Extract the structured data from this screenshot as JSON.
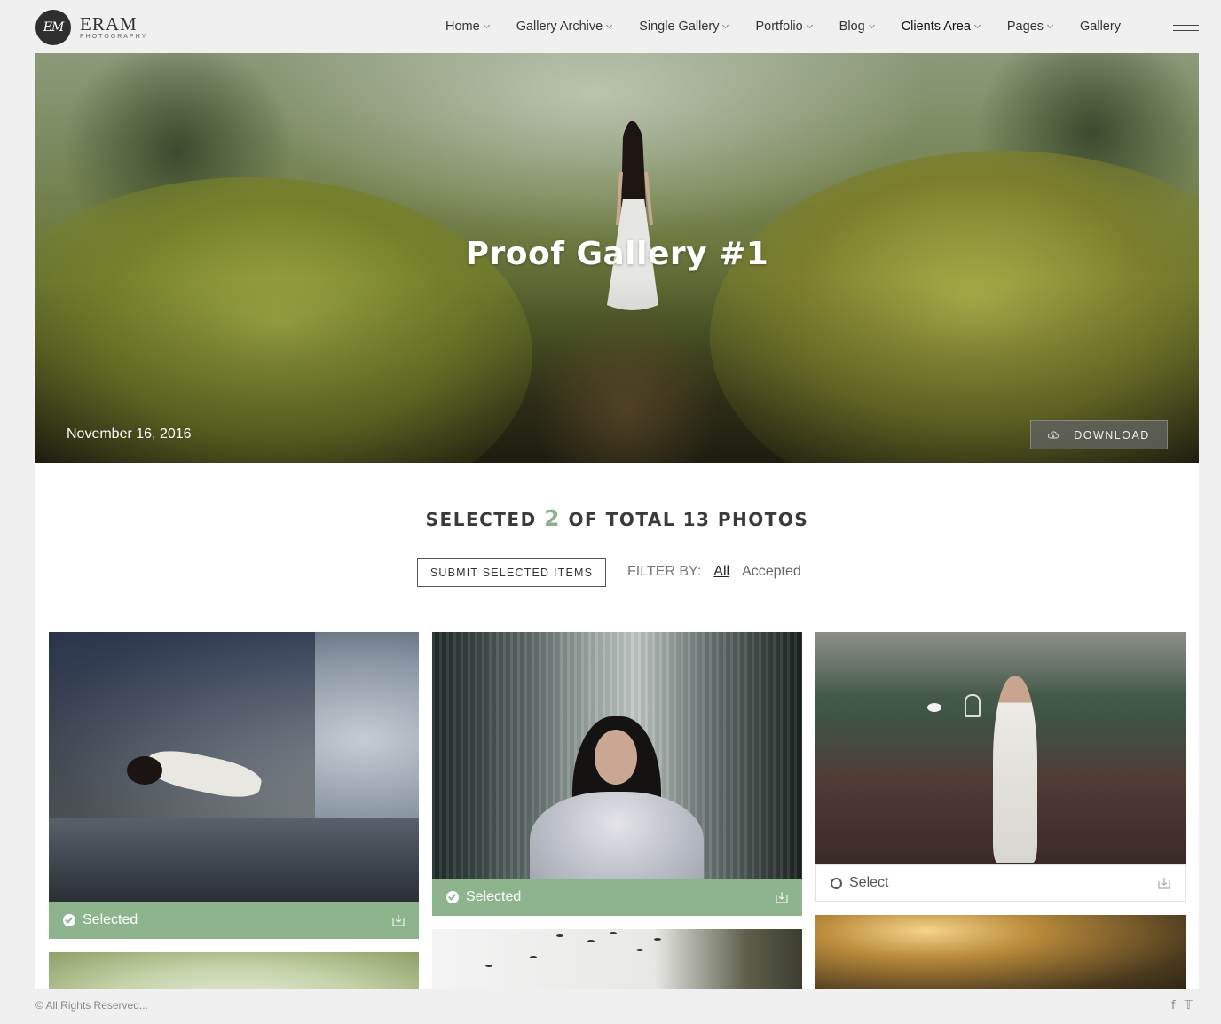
{
  "logo": {
    "monogram": "EM",
    "name": "ERAM",
    "tagline": "PHOTOGRAPHY"
  },
  "nav": [
    {
      "label": "Home",
      "dropdown": true
    },
    {
      "label": "Gallery Archive",
      "dropdown": true
    },
    {
      "label": "Single Gallery",
      "dropdown": true
    },
    {
      "label": "Portfolio",
      "dropdown": true
    },
    {
      "label": "Blog",
      "dropdown": true
    },
    {
      "label": "Clients Area",
      "dropdown": true,
      "active": true
    },
    {
      "label": "Pages",
      "dropdown": true
    },
    {
      "label": "Gallery",
      "dropdown": false
    }
  ],
  "hero": {
    "title": "Proof Gallery #1",
    "date": "November 16, 2016",
    "download_label": "DOWNLOAD"
  },
  "summary": {
    "prefix": "SELECTED",
    "selected_count": "2",
    "suffix": "OF TOTAL 13 PHOTOS"
  },
  "actions": {
    "submit_label": "SUBMIT SELECTED ITEMS",
    "filter_label": "FILTER BY:",
    "filter_options": [
      "All",
      "Accepted"
    ],
    "filter_active": "All"
  },
  "photos": [
    {
      "status_label": "Selected",
      "selected": true
    },
    {
      "status_label": "Selected",
      "selected": true
    },
    {
      "status_label": "Select",
      "selected": false
    }
  ],
  "footer": {
    "copyright": "© All Rights Reserved...",
    "social": [
      "facebook-icon",
      "twitter-icon"
    ]
  },
  "colors": {
    "accent_green": "#8eb48d",
    "text_dark": "#333333",
    "page_bg": "#f0f0f0"
  }
}
